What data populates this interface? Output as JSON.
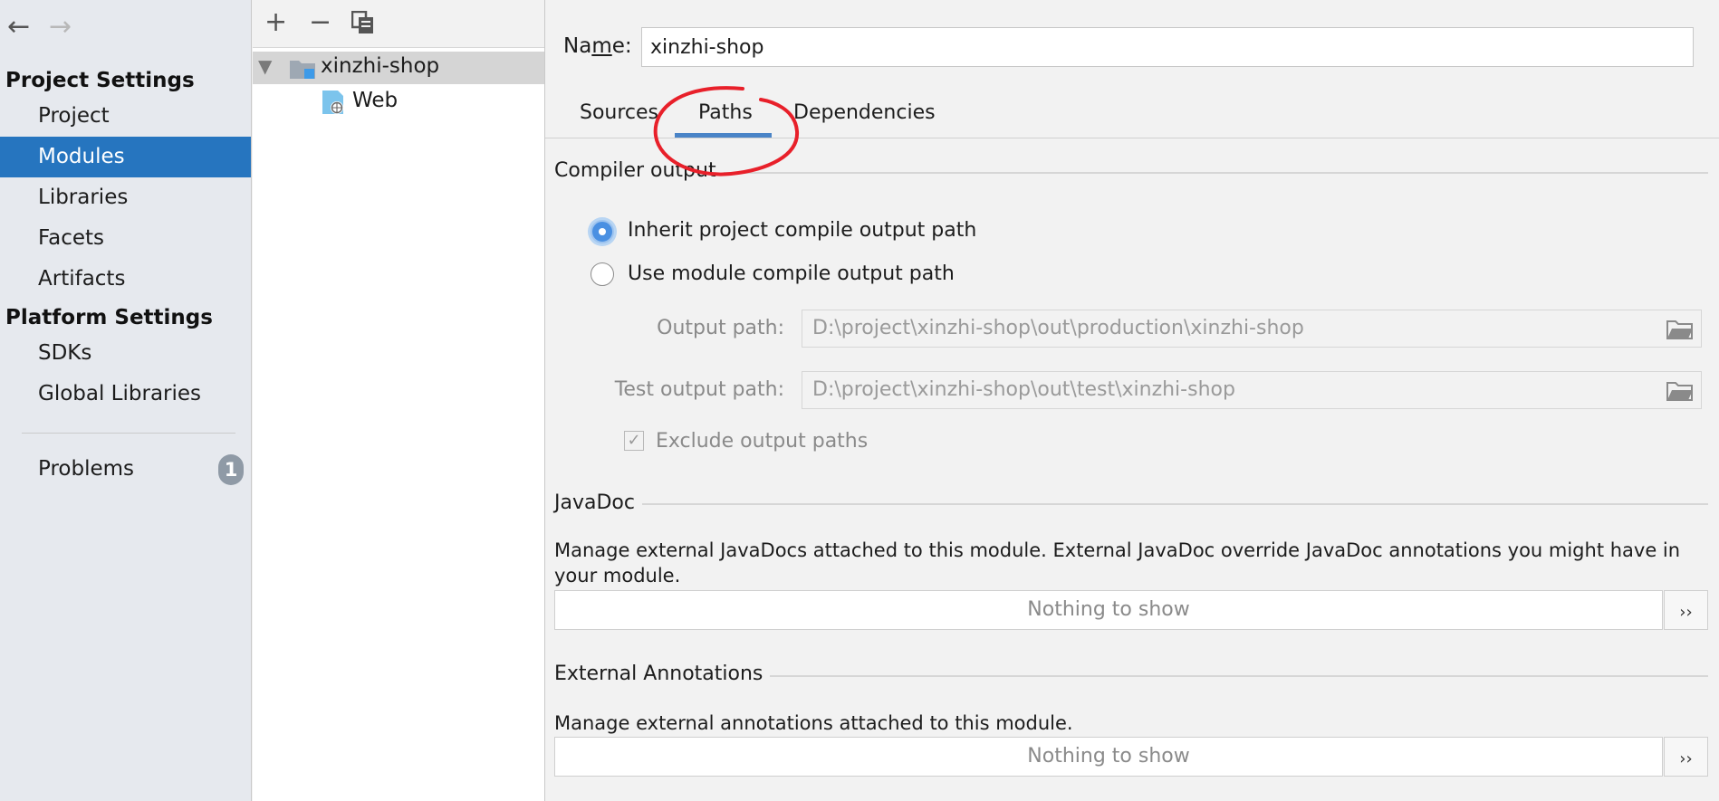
{
  "nav": {
    "back_icon": "arrow-left-icon",
    "forward_icon": "arrow-right-icon"
  },
  "sidebar": {
    "project_settings_title": "Project Settings",
    "project_items": [
      {
        "label": "Project"
      },
      {
        "label": "Modules",
        "selected": true
      },
      {
        "label": "Libraries"
      },
      {
        "label": "Facets"
      },
      {
        "label": "Artifacts"
      }
    ],
    "platform_settings_title": "Platform Settings",
    "platform_items": [
      {
        "label": "SDKs"
      },
      {
        "label": "Global Libraries"
      }
    ],
    "problems": {
      "label": "Problems",
      "count": "1"
    }
  },
  "module_tree": {
    "toolbar": {
      "add": "+",
      "remove": "−",
      "copy_icon": "copy-icon"
    },
    "root": {
      "label": "xinzhi-shop",
      "expanded": true
    },
    "children": [
      {
        "label": "Web"
      }
    ]
  },
  "module": {
    "name_label_prefix": "Na",
    "name_label_mnemonic": "m",
    "name_label_suffix": "e:",
    "name_value": "xinzhi-shop",
    "tabs": [
      {
        "label": "Sources"
      },
      {
        "label": "Paths",
        "active": true
      },
      {
        "label": "Dependencies"
      }
    ],
    "compiler_output": {
      "title": "Compiler output",
      "inherit_option": "Inherit project compile output path",
      "module_option": "Use module compile output path",
      "selected": "inherit",
      "output_path_label": "Output path:",
      "output_path_value": "D:\\project\\xinzhi-shop\\out\\production\\xinzhi-shop",
      "test_output_path_label": "Test output path:",
      "test_output_path_value": "D:\\project\\xinzhi-shop\\out\\test\\xinzhi-shop",
      "exclude_label": "Exclude output paths",
      "exclude_checked": true
    },
    "javadoc": {
      "title": "JavaDoc",
      "description": "Manage external JavaDocs attached to this module. External JavaDoc override JavaDoc annotations you might have in your module.",
      "empty_text": "Nothing to show",
      "more_label": "››"
    },
    "external_annotations": {
      "title": "External Annotations",
      "description": "Manage external annotations attached to this module.",
      "empty_text": "Nothing to show",
      "more_label": "››"
    }
  },
  "colors": {
    "selection": "#2675bf",
    "tab_underline": "#4a84c7",
    "annotation": "#e8202a"
  }
}
